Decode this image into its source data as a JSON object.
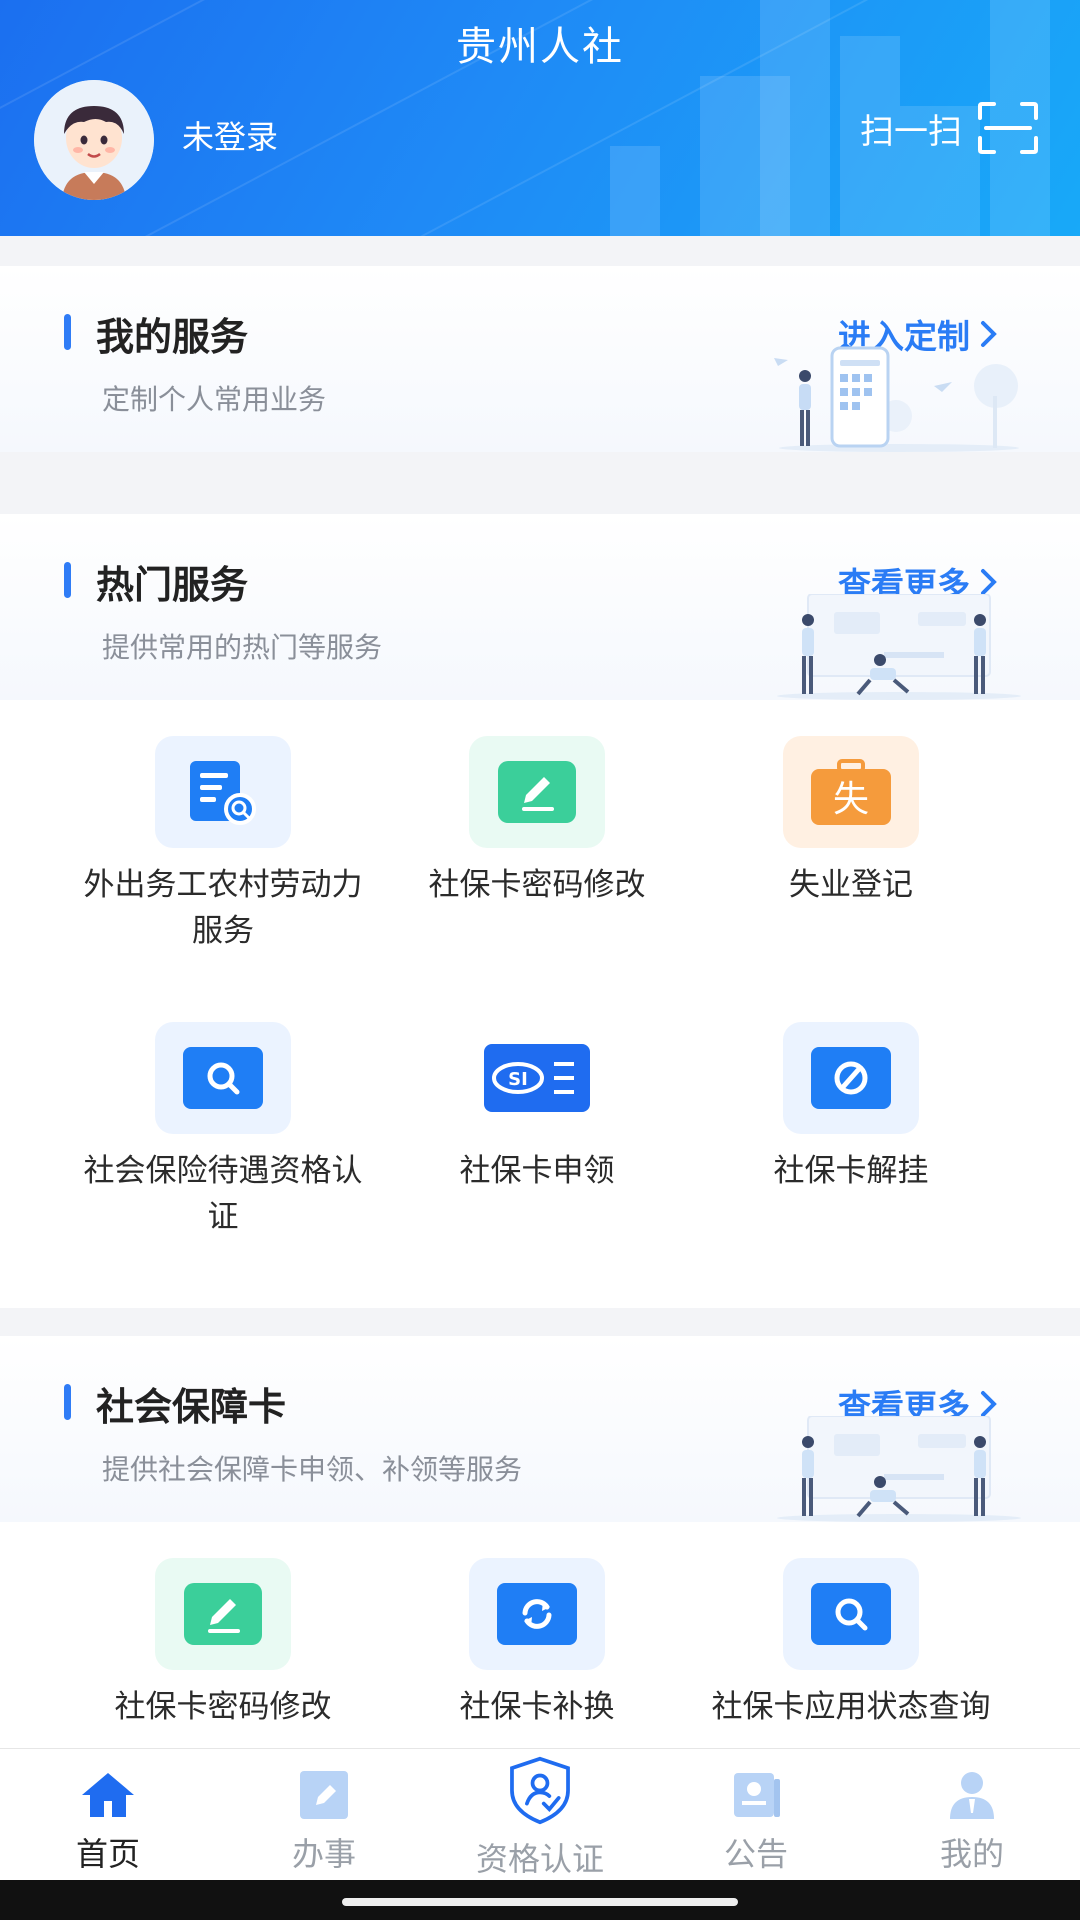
{
  "header": {
    "title": "贵州人社",
    "login_text": "未登录",
    "scan_label": "扫一扫"
  },
  "my_services": {
    "title": "我的服务",
    "subtitle": "定制个人常用业务",
    "action": "进入定制"
  },
  "hot_services": {
    "title": "热门服务",
    "subtitle": "提供常用的热门等服务",
    "action": "查看更多",
    "items": [
      {
        "label": "外出务工农村劳动力服务",
        "icon": "document-search-icon"
      },
      {
        "label": "社保卡密码修改",
        "icon": "edit-icon"
      },
      {
        "label": "失业登记",
        "icon": "briefcase-icon",
        "icon_text": "失"
      },
      {
        "label": "社会保险待遇资格认证",
        "icon": "search-icon"
      },
      {
        "label": "社保卡申领",
        "icon": "social-card-icon",
        "icon_text": "SI"
      },
      {
        "label": "社保卡解挂",
        "icon": "block-icon"
      }
    ]
  },
  "social_card": {
    "title": "社会保障卡",
    "subtitle": "提供社会保障卡申领、补领等服务",
    "action": "查看更多",
    "items": [
      {
        "label": "社保卡密码修改",
        "icon": "edit-icon"
      },
      {
        "label": "社保卡补换",
        "icon": "refresh-icon"
      },
      {
        "label": "社保卡应用状态查询",
        "icon": "search-icon"
      }
    ]
  },
  "bottom_nav": [
    {
      "label": "首页",
      "icon": "home-icon",
      "active": true
    },
    {
      "label": "办事",
      "icon": "edit-pad-icon",
      "active": false
    },
    {
      "label": "资格认证",
      "icon": "shield-user-icon",
      "active": false
    },
    {
      "label": "公告",
      "icon": "notice-icon",
      "active": false
    },
    {
      "label": "我的",
      "icon": "user-icon",
      "active": false
    }
  ],
  "colors": {
    "primary": "#2a7cf5",
    "header_start": "#1b6ff0",
    "header_end": "#18a9f8",
    "green_tile": "#3bcf9a",
    "orange_tile": "#f59b3c"
  }
}
